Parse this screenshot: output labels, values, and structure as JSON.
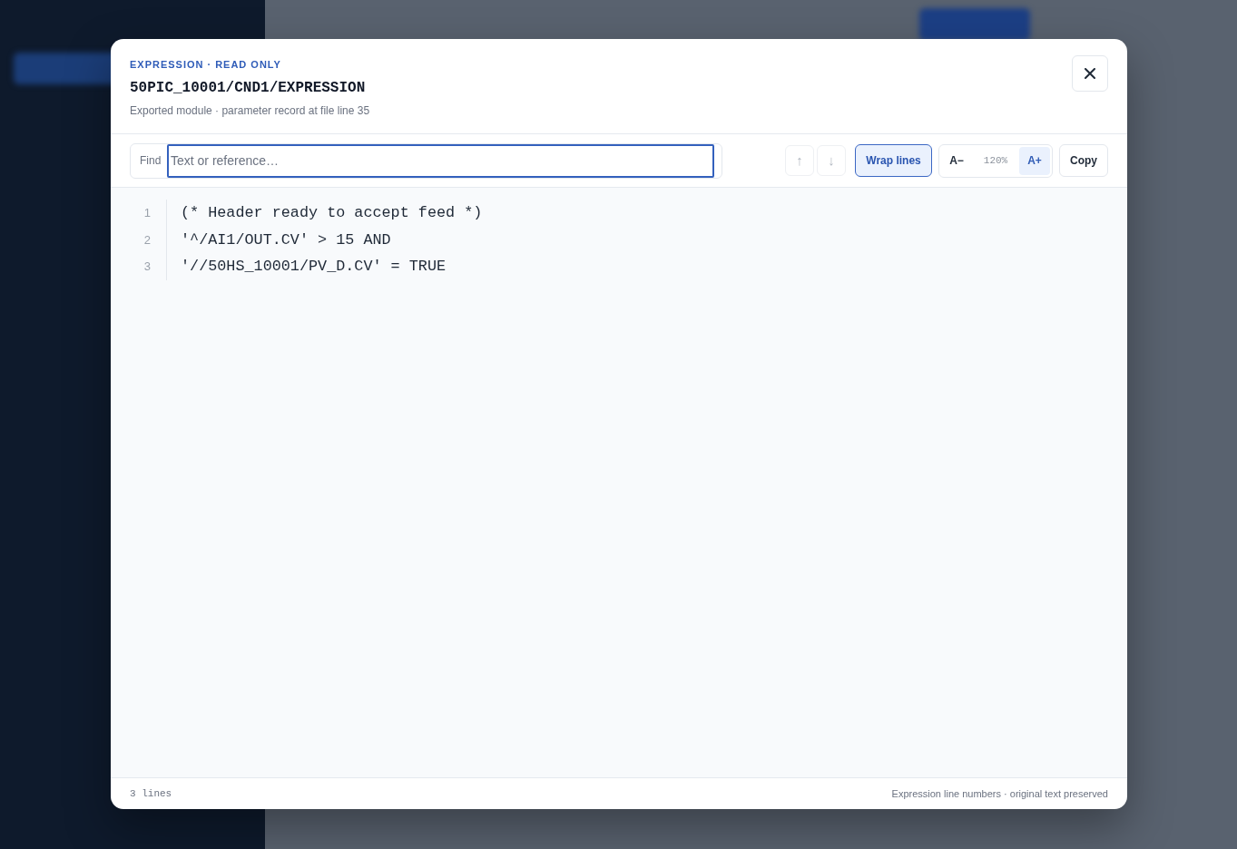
{
  "dialog": {
    "kicker": "EXPRESSION · READ ONLY",
    "title": "50PIC_10001/CND1/EXPRESSION",
    "subtitle": "Exported module · parameter record at file line 35"
  },
  "find": {
    "label": "Find",
    "placeholder": "Text or reference…",
    "focused": true
  },
  "match_buttons": [
    {
      "label": "↑",
      "disabled": true
    },
    {
      "label": "↓",
      "disabled": true
    }
  ],
  "wrap": {
    "label": "Wrap lines",
    "on": true
  },
  "font_size": {
    "decrease": {
      "label": "A−",
      "highlighted": false
    },
    "reading": "120%",
    "increase": {
      "label": "A+",
      "highlighted": true
    }
  },
  "copy": {
    "label": "Copy"
  },
  "code": {
    "lines": [
      {
        "number": "1",
        "text": "(* Header ready to accept feed *)"
      },
      {
        "number": "2",
        "text": "'^/AI1/OUT.CV' > 15 AND"
      },
      {
        "number": "3",
        "text": "'//50HS_10001/PV_D.CV' = TRUE"
      }
    ]
  },
  "footer": {
    "line_count": "3 lines",
    "note": "Expression line numbers · original text preserved"
  }
}
